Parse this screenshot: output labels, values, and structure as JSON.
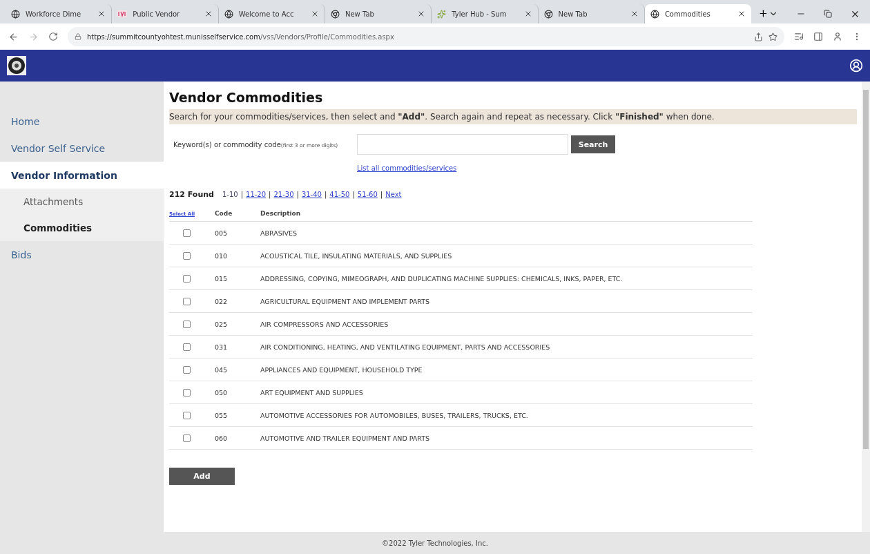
{
  "browser": {
    "tabs": [
      {
        "title": "Workforce Dime",
        "kind": "globe",
        "selected": false
      },
      {
        "title": "Public Vendor",
        "kind": "vendor",
        "selected": false
      },
      {
        "title": "Welcome to Acc",
        "kind": "globe",
        "selected": false
      },
      {
        "title": "New Tab",
        "kind": "newtab",
        "selected": false
      },
      {
        "title": "Tyler Hub - Sum",
        "kind": "tyler",
        "selected": false
      },
      {
        "title": "New Tab",
        "kind": "newtab",
        "selected": false
      },
      {
        "title": "Commodities",
        "kind": "globe",
        "selected": true
      }
    ],
    "url": {
      "host": "https://summitcountyohtest.munisselfservice.com",
      "path": "/vss/Vendors/Profile/Commodities.aspx"
    }
  },
  "sidebar": {
    "items": [
      {
        "label": "Home",
        "selected": false
      },
      {
        "label": "Vendor Self Service",
        "selected": false
      },
      {
        "label": "Vendor Information",
        "selected": true,
        "children": [
          {
            "label": "Attachments",
            "selected": false
          },
          {
            "label": "Commodities",
            "selected": true
          }
        ]
      },
      {
        "label": "Bids",
        "selected": false
      }
    ]
  },
  "page": {
    "title": "Vendor Commodities",
    "instructions": "Search for your commodities/services, then select and **\"Add\"**. Search again and repeat as necessary. Click **\"Finished\"** when done.",
    "search": {
      "label": "Keyword(s) or commodity code",
      "hint": "(first 3 or more digits)",
      "button": "Search"
    },
    "list_all_link": "List all commodities/services",
    "results": {
      "count": "212 Found",
      "separator": "|",
      "pages": [
        {
          "label": "1-10",
          "selected": true
        },
        {
          "label": "11-20",
          "selected": false
        },
        {
          "label": "21-30",
          "selected": false
        },
        {
          "label": "31-40",
          "selected": false
        },
        {
          "label": "41-50",
          "selected": false
        },
        {
          "label": "51-60",
          "selected": false
        }
      ],
      "next": "Next"
    },
    "table": {
      "columns": [
        "Select All",
        "Code",
        "Description"
      ],
      "rows": [
        {
          "code": "005",
          "description": "ABRASIVES",
          "checked": false
        },
        {
          "code": "010",
          "description": "ACOUSTICAL TILE, INSULATING MATERIALS, AND SUPPLIES",
          "checked": false
        },
        {
          "code": "015",
          "description": "ADDRESSING, COPYING, MIMEOGRAPH, AND DUPLICATING MACHINE SUPPLIES: CHEMICALS, INKS, PAPER, ETC.",
          "checked": false
        },
        {
          "code": "022",
          "description": "AGRICULTURAL EQUIPMENT AND IMPLEMENT PARTS",
          "checked": false
        },
        {
          "code": "025",
          "description": "AIR COMPRESSORS AND ACCESSORIES",
          "checked": false
        },
        {
          "code": "031",
          "description": "AIR CONDITIONING, HEATING, AND VENTILATING EQUIPMENT, PARTS AND ACCESSORIES",
          "checked": false
        },
        {
          "code": "045",
          "description": "APPLIANCES AND EQUIPMENT, HOUSEHOLD TYPE",
          "checked": false
        },
        {
          "code": "050",
          "description": "ART EQUIPMENT AND SUPPLIES",
          "checked": false
        },
        {
          "code": "055",
          "description": "AUTOMOTIVE ACCESSORIES FOR AUTOMOBILES, BUSES, TRAILERS, TRUCKS, ETC.",
          "checked": false
        },
        {
          "code": "060",
          "description": "AUTOMOTIVE AND TRAILER EQUIPMENT AND PARTS",
          "checked": false
        }
      ]
    },
    "add_button": "Add"
  },
  "footer": "©2022 Tyler Technologies, Inc."
}
